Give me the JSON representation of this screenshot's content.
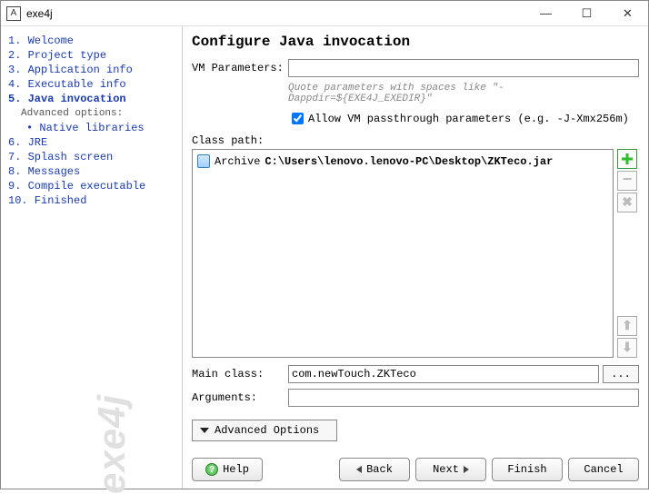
{
  "window": {
    "title": "exe4j"
  },
  "sidebar": {
    "steps": [
      "1. Welcome",
      "2. Project type",
      "3. Application info",
      "4. Executable info",
      "5. Java invocation",
      "6. JRE",
      "7. Splash screen",
      "8. Messages",
      "9. Compile executable",
      "10. Finished"
    ],
    "current_index": 4,
    "advanced_header": "Advanced options:",
    "advanced_items": [
      "• Native libraries"
    ],
    "brand": "exe4j"
  },
  "main": {
    "heading": "Configure Java invocation",
    "vm_label": "VM Parameters:",
    "vm_value": "",
    "vm_hint": "Quote parameters with spaces like \"-Dappdir=${EXE4J_EXEDIR}\"",
    "passthrough_checked": true,
    "passthrough_label": "Allow VM passthrough parameters (e.g. -J-Xmx256m)",
    "classpath_label": "Class path:",
    "classpath": [
      {
        "type": "Archive",
        "path": "C:\\Users\\lenovo.lenovo-PC\\Desktop\\ZKTeco.jar"
      }
    ],
    "mainclass_label": "Main class:",
    "mainclass_value": "com.newTouch.ZKTeco",
    "arguments_label": "Arguments:",
    "arguments_value": "",
    "advanced_options": "Advanced Options",
    "buttons": {
      "help": "Help",
      "back": "Back",
      "next": "Next",
      "finish": "Finish",
      "cancel": "Cancel"
    },
    "browse": "..."
  }
}
